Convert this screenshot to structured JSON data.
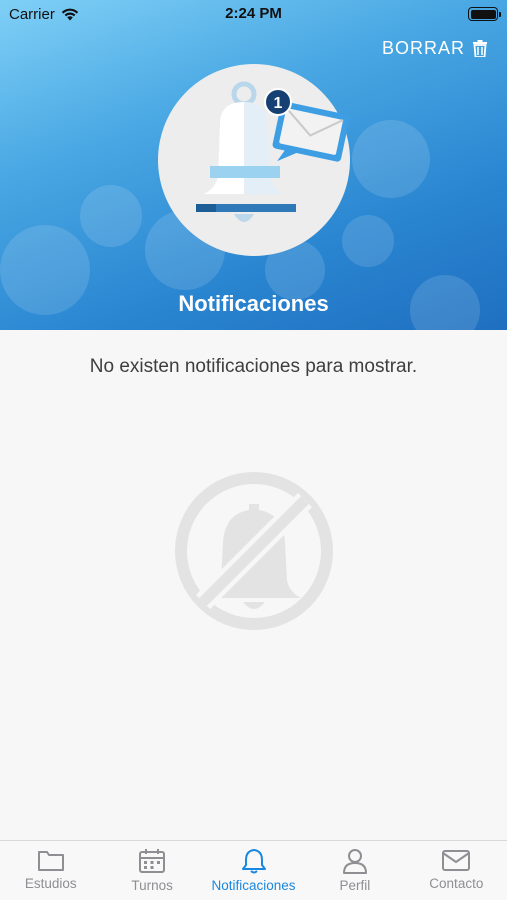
{
  "status_bar": {
    "carrier": "Carrier",
    "time": "2:24 PM"
  },
  "header": {
    "clear_label": "BORRAR",
    "title": "Notificaciones",
    "badge_count": "1"
  },
  "empty_state": {
    "message": "No existen notificaciones para mostrar."
  },
  "tabs": [
    {
      "label": "Estudios",
      "icon": "folder-icon",
      "active": false
    },
    {
      "label": "Turnos",
      "icon": "calendar-icon",
      "active": false
    },
    {
      "label": "Notificaciones",
      "icon": "bell-icon",
      "active": true
    },
    {
      "label": "Perfil",
      "icon": "person-icon",
      "active": false
    },
    {
      "label": "Contacto",
      "icon": "envelope-icon",
      "active": false
    }
  ],
  "colors": {
    "accent": "#1a88e0",
    "header_gradient_start": "#7fd0f6",
    "header_gradient_end": "#1f6fc0",
    "inactive_tab": "#8e8e93"
  }
}
